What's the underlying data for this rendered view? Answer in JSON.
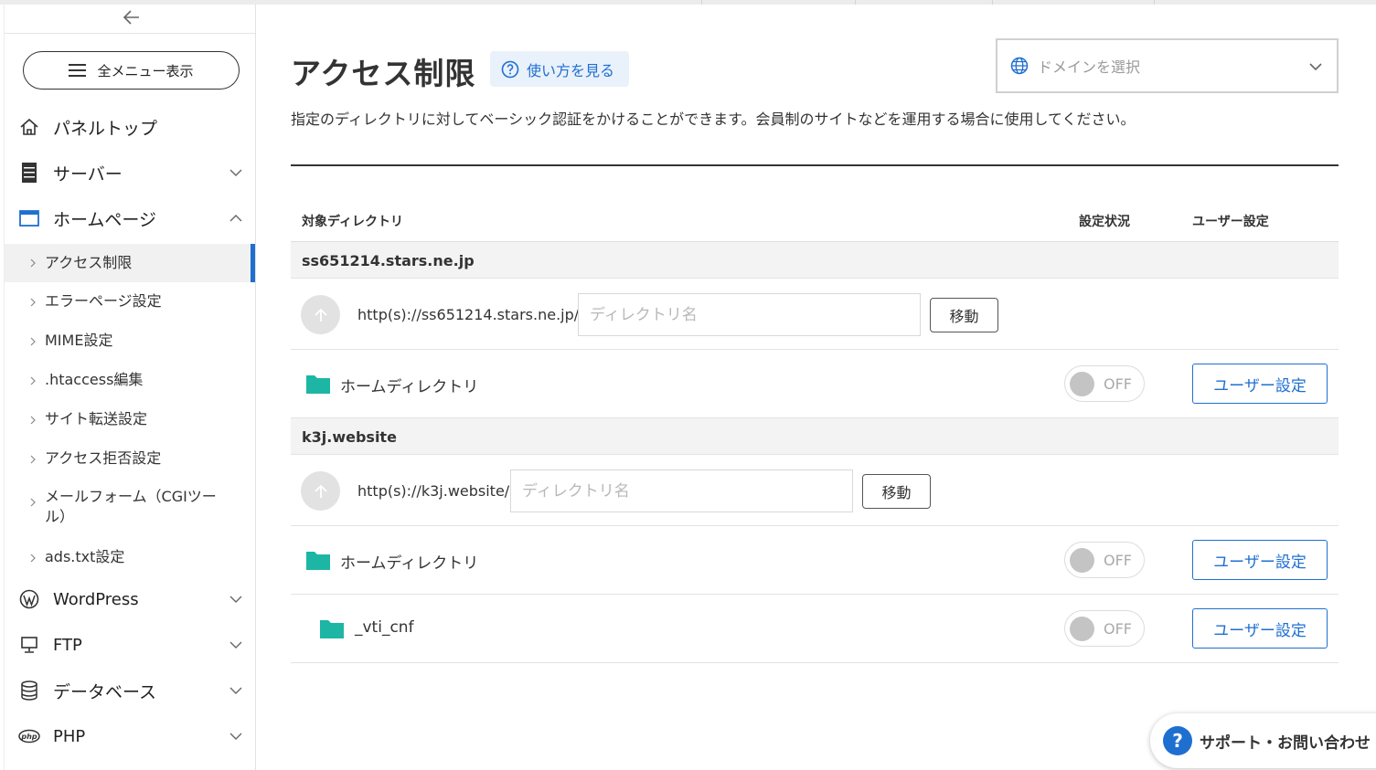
{
  "sidebar": {
    "all_menu_label": "全メニュー表示",
    "items": [
      {
        "label": "パネルトップ",
        "icon": "home-icon"
      },
      {
        "label": "サーバー",
        "icon": "server-icon"
      },
      {
        "label": "ホームページ",
        "icon": "browser-window-icon"
      },
      {
        "label": "WordPress",
        "icon": "wordpress-icon"
      },
      {
        "label": "FTP",
        "icon": "monitor-icon"
      },
      {
        "label": "データベース",
        "icon": "database-icon"
      },
      {
        "label": "PHP",
        "icon": "php-icon"
      }
    ],
    "sub_items": [
      {
        "label": "アクセス制限"
      },
      {
        "label": "エラーページ設定"
      },
      {
        "label": "MIME設定"
      },
      {
        "label": ".htaccess編集"
      },
      {
        "label": "サイト転送設定"
      },
      {
        "label": "アクセス拒否設定"
      },
      {
        "label": "メールフォーム（CGIツール）"
      },
      {
        "label": "ads.txt設定"
      }
    ]
  },
  "header": {
    "title": "アクセス制限",
    "help_label": "使い方を見る",
    "domain_placeholder": "ドメインを選択",
    "description": "指定のディレクトリに対してベーシック認証をかけることができます。会員制のサイトなどを運用する場合に使用してください。"
  },
  "table": {
    "columns": {
      "directory": "対象ディレクトリ",
      "status": "設定状況",
      "user": "ユーザー設定"
    },
    "move_label": "移動",
    "input_placeholder": "ディレクトリ名",
    "toggle_off_label": "OFF",
    "user_button_label": "ユーザー設定",
    "domains": [
      {
        "name": "ss651214.stars.ne.jp",
        "path": "http(s)://ss651214.stars.ne.jp/",
        "dirs": [
          {
            "name": "ホームディレクトリ",
            "status": "OFF"
          }
        ]
      },
      {
        "name": "k3j.website",
        "path": "http(s)://k3j.website/",
        "dirs": [
          {
            "name": "ホームディレクトリ",
            "status": "OFF"
          },
          {
            "name": "_vti_cnf",
            "status": "OFF"
          }
        ]
      }
    ]
  },
  "support": {
    "label": "サポート・お問い合わせ"
  },
  "colors": {
    "accent": "#1f6fd1",
    "folder": "#1db6a5",
    "domain_row_bg": "#f3f3f3"
  }
}
